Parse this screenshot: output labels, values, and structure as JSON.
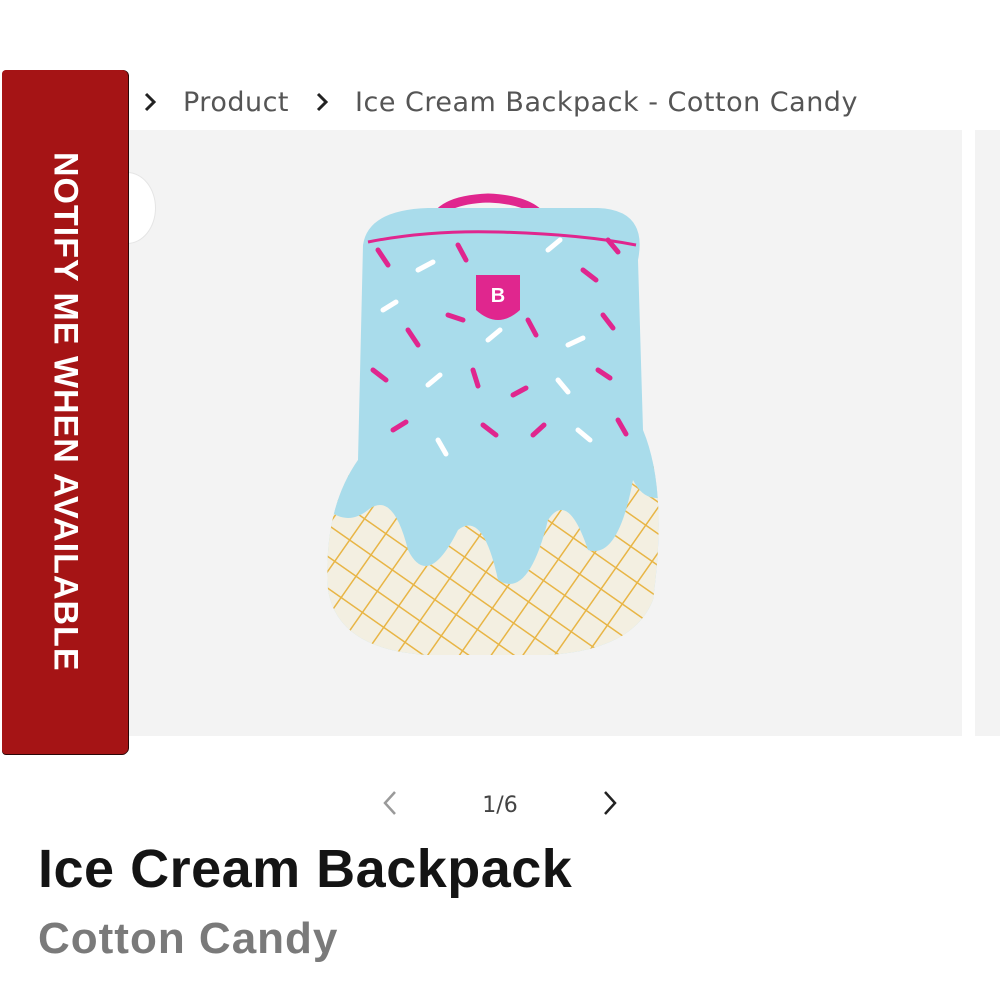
{
  "breadcrumb": {
    "items": [
      "Product",
      "Ice Cream Backpack - Cotton Candy"
    ]
  },
  "notify": {
    "label": "NOTIFY ME WHEN AVAILABLE"
  },
  "gallery": {
    "counter": "1/6"
  },
  "product": {
    "title": "Ice Cream Backpack",
    "variant": "Cotton Candy"
  },
  "colors": {
    "notify_bg": "#a51415",
    "bag_blue": "#a9dceb",
    "sprinkle_pink": "#e0268e",
    "cone_yellow": "#e8b545",
    "cone_cream": "#f3efe1"
  },
  "icons": {
    "breadcrumb_separator": "chevron-right-icon",
    "pager_prev": "chevron-left-icon",
    "pager_next": "chevron-right-icon"
  }
}
